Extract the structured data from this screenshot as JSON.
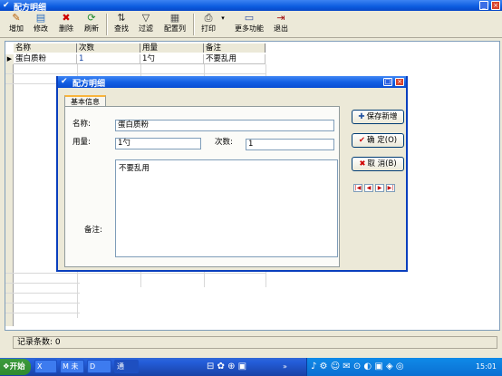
{
  "main_window": {
    "title": "配方明细",
    "controls": [
      "_",
      "×"
    ]
  },
  "toolbar": [
    {
      "label": "增加",
      "icon": "add-icon"
    },
    {
      "label": "修改",
      "icon": "edit-icon"
    },
    {
      "label": "删除",
      "icon": "delete-icon"
    },
    {
      "label": "刷新",
      "icon": "refresh-icon"
    },
    {
      "label": "查找",
      "icon": "find-icon"
    },
    {
      "label": "过滤",
      "icon": "filter-icon"
    },
    {
      "label": "配置列",
      "icon": "config-columns-icon"
    },
    {
      "label": "打印",
      "icon": "print-icon"
    },
    {
      "label": "更多功能",
      "icon": "more-icon"
    },
    {
      "label": "退出",
      "icon": "exit-icon"
    }
  ],
  "grid": {
    "columns": [
      "名称",
      "次数",
      "用量",
      "备注"
    ],
    "rows": [
      {
        "selector": "▶",
        "cells": [
          "蛋白质粉",
          "1",
          "1勺",
          "不要乱用"
        ]
      }
    ]
  },
  "status": {
    "text": "记录条数: 0"
  },
  "dialog": {
    "title": "配方明细",
    "controls": [
      "□",
      "×"
    ],
    "tab": "基本信息",
    "fields": {
      "name_label": "名称:",
      "name_value": "蛋白质粉",
      "amount_label": "用量:",
      "amount_value": "1勺",
      "count_label": "次数:",
      "count_value": "1",
      "note_label": "备注:",
      "note_value": "不要乱用"
    },
    "buttons": {
      "save_new": "保存新增",
      "save_new_icon": "✚",
      "confirm": "确 定(O)",
      "confirm_icon": "✔",
      "cancel": "取 消(B)",
      "cancel_icon": "✖"
    },
    "nav": [
      "|◀",
      "◀",
      "▶",
      "▶|"
    ]
  },
  "taskbar": {
    "start": "开始",
    "tasks": [
      "X",
      "M 未",
      "D",
      "通"
    ],
    "clock": "15:01"
  }
}
